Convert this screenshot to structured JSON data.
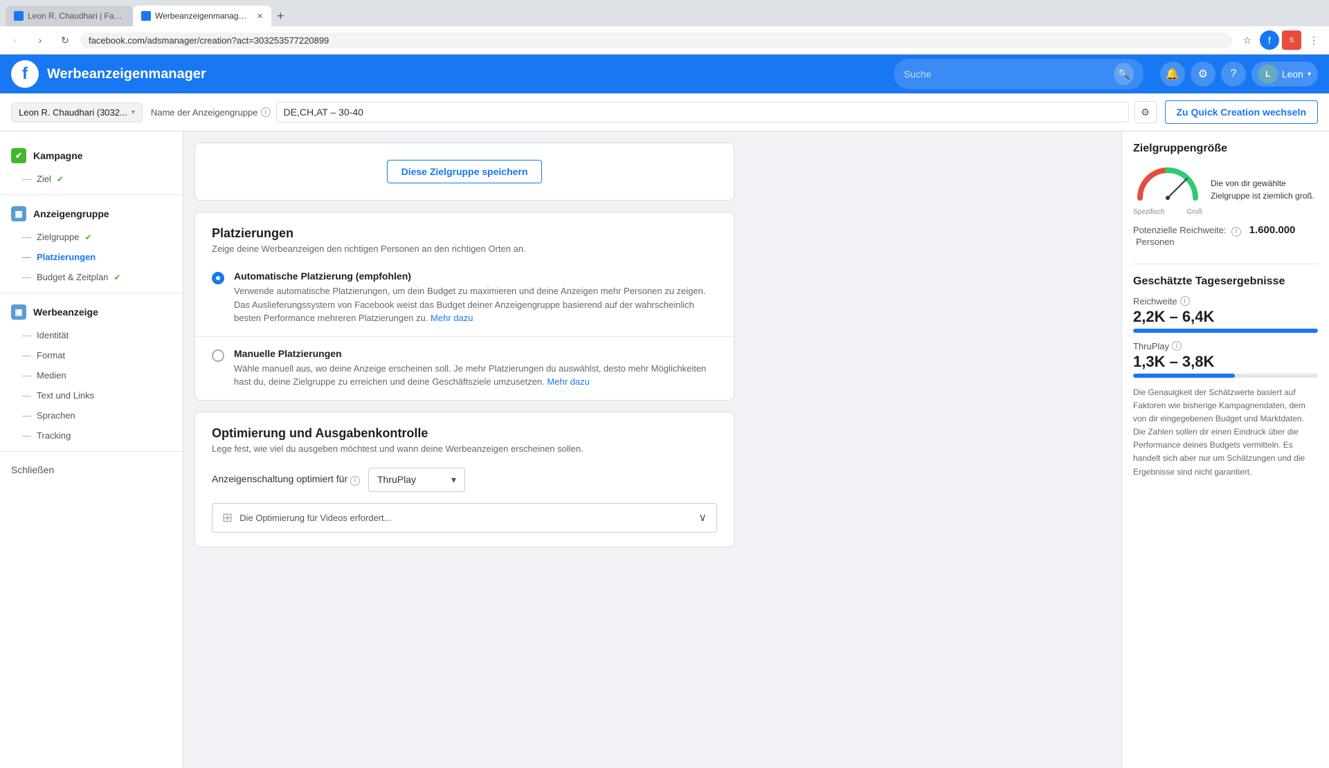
{
  "browser": {
    "tabs": [
      {
        "id": "tab1",
        "favicon_type": "facebook",
        "label": "Leon R. Chaudhari | Facebook",
        "active": false
      },
      {
        "id": "tab2",
        "favicon_type": "fb_ads",
        "label": "Werbeanzeigenmanager - Cre...",
        "active": true
      }
    ],
    "add_tab_label": "+",
    "address": "facebook.com/adsmanager/creation?act=303253577220899",
    "nav": {
      "back": "‹",
      "forward": "›",
      "reload": "↻"
    }
  },
  "appbar": {
    "logo": "f",
    "title": "Werbeanzeigenmanager",
    "search_placeholder": "Suche",
    "user_name": "Leon",
    "icons": [
      "🔔",
      "⚙",
      "?"
    ]
  },
  "header": {
    "account_name": "Leon R. Chaudhari (3032...",
    "adgroup_label": "Name der Anzeigengruppe",
    "adgroup_info": "ℹ",
    "adgroup_value": "DE,CH,AT – 30-40",
    "quick_creation_label": "Zu Quick Creation wechseln"
  },
  "sidebar": {
    "sections": [
      {
        "id": "kampagne",
        "icon": "✔",
        "icon_color": "green",
        "label": "Kampagne",
        "items": [
          {
            "id": "ziel",
            "label": "Ziel",
            "state": "check"
          }
        ]
      },
      {
        "id": "anzeigengruppe",
        "icon": "▦",
        "icon_color": "blue",
        "label": "Anzeigengruppe",
        "items": [
          {
            "id": "zielgruppe",
            "label": "Zielgruppe",
            "state": "check"
          },
          {
            "id": "platzierungen",
            "label": "Platzierungen",
            "state": "active"
          },
          {
            "id": "budget",
            "label": "Budget & Zeitplan",
            "state": "check"
          }
        ]
      },
      {
        "id": "werbeanzeige",
        "icon": "▣",
        "icon_color": "blue",
        "label": "Werbeanzeige",
        "items": [
          {
            "id": "identitaet",
            "label": "Identität",
            "state": ""
          },
          {
            "id": "format",
            "label": "Format",
            "state": ""
          },
          {
            "id": "medien",
            "label": "Medien",
            "state": ""
          },
          {
            "id": "text_links",
            "label": "Text und Links",
            "state": ""
          },
          {
            "id": "sprachen",
            "label": "Sprachen",
            "state": ""
          },
          {
            "id": "tracking",
            "label": "Tracking",
            "state": ""
          }
        ]
      }
    ],
    "close_label": "Schließen"
  },
  "content": {
    "save_audience_btn": "Diese Zielgruppe speichern",
    "placements": {
      "title": "Platzierungen",
      "subtitle": "Zeige deine Werbeanzeigen den richtigen Personen an den richtigen Orten an.",
      "options": [
        {
          "id": "auto",
          "selected": true,
          "title": "Automatische Platzierung (empfohlen)",
          "description": "Verwende automatische Platzierungen, um dein Budget zu maximieren und deine Anzeigen mehr Personen zu zeigen. Das Auslieferungssystem von Facebook weist das Budget deiner Anzeigengruppe basierend auf der wahrscheinlich besten Performance mehreren Platzierungen zu.",
          "link_text": "Mehr dazu"
        },
        {
          "id": "manual",
          "selected": false,
          "title": "Manuelle Platzierungen",
          "description": "Wähle manuell aus, wo deine Anzeige erscheinen soll. Je mehr Platzierungen du auswählst, desto mehr Möglichkeiten hast du, deine Zielgruppe zu erreichen und deine Geschäftsziele umzusetzen.",
          "link_text": "Mehr dazu"
        }
      ]
    },
    "optimization": {
      "title": "Optimierung und Ausgabenkontrolle",
      "subtitle": "Lege fest, wie viel du ausgeben möchtest und wann deine Werbeanzeigen erscheinen sollen.",
      "form_label": "Anzeigenschaltung optimiert für",
      "form_info": "ℹ",
      "dropdown_value": "ThruPlay",
      "expand_text": "Die Optimierung für Videos erfordert...",
      "expand_icon": "⊞",
      "expand_chevron": "∨"
    }
  },
  "right_panel": {
    "audience_size": {
      "title": "Zielgruppengröße",
      "gauge_label_left": "Spezifisch",
      "gauge_label_right": "Groß",
      "description": "Die von dir gewählte Zielgruppe ist ziemlich groß.",
      "reach_label": "Potenzielle Reichweite:",
      "reach_value": "1.600.000",
      "reach_suffix": "Personen"
    },
    "daily_results": {
      "title": "Geschätzte Tagesergebnisse",
      "stats": [
        {
          "id": "reichweite",
          "label": "Reichweite",
          "value": "2,2K – 6,4K",
          "bar_percent": 100
        },
        {
          "id": "thruplay",
          "label": "ThruPlay",
          "value": "1,3K – 3,8K",
          "bar_percent": 55
        }
      ],
      "note": "Die Genauigkeit der Schätzwerte basiert auf Faktoren wie bisherige Kampagnendaten, dem von dir eingegebenen Budget und Marktdaten. Die Zahlen sollen dir einen Eindruck über die Performance deines Budgets vermitteln. Es handelt sich aber nur um Schätzungen und die Ergebnisse sind nicht garantiert."
    }
  }
}
